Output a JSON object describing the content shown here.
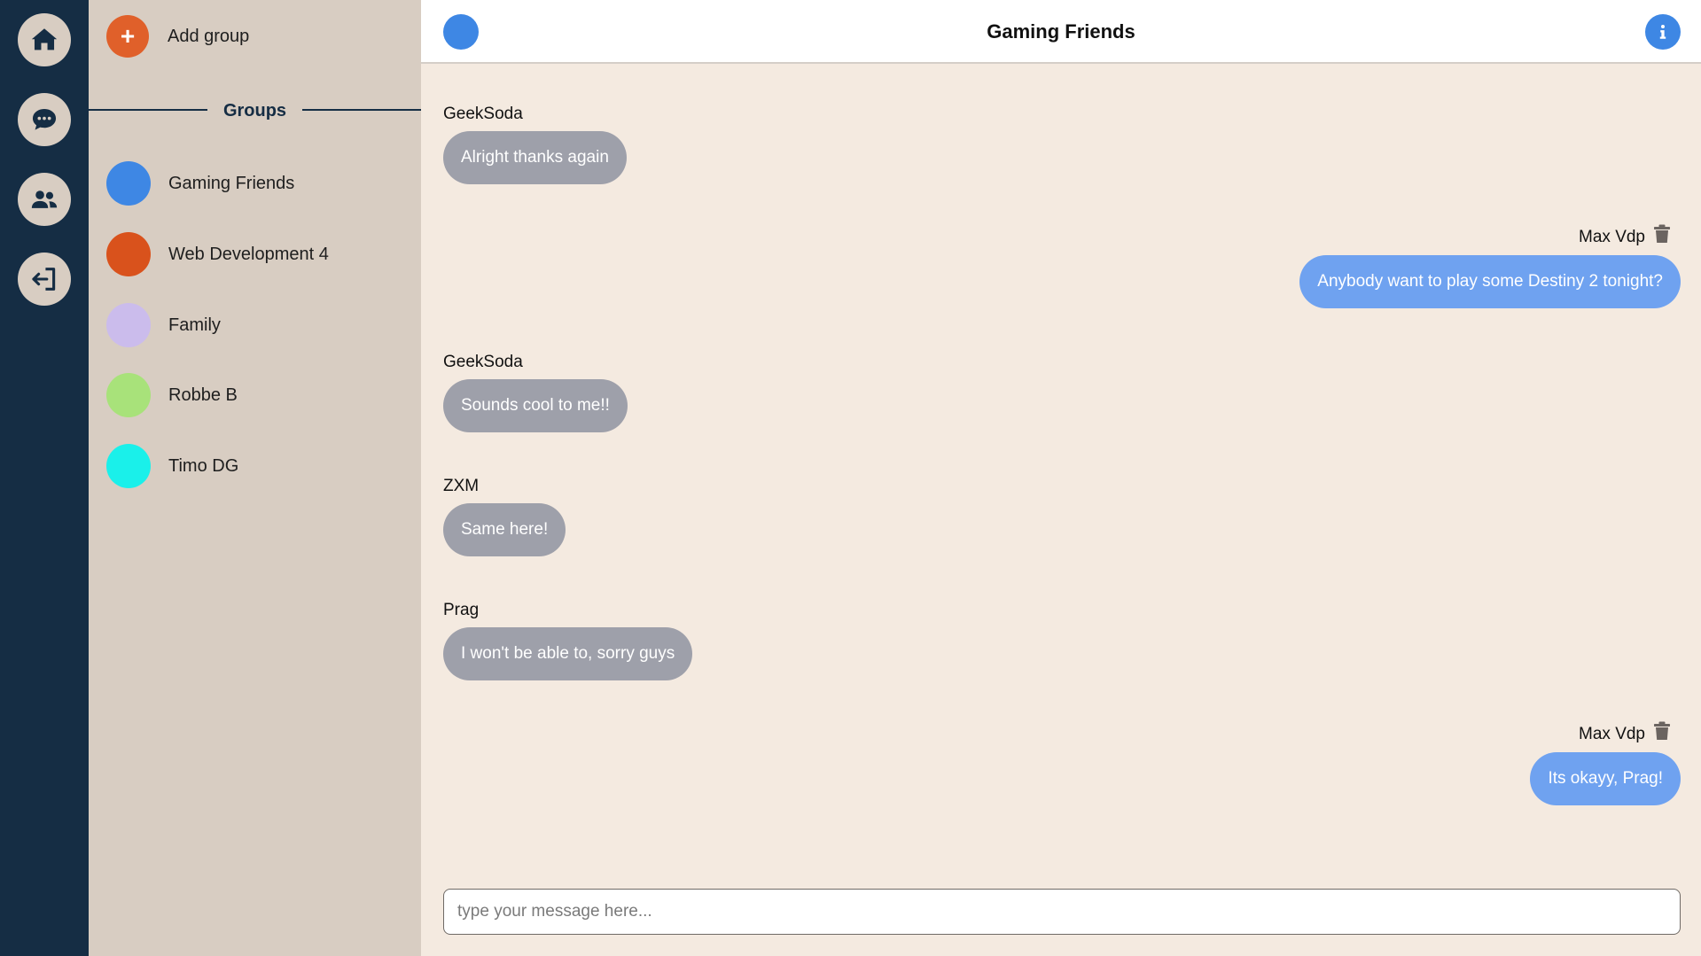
{
  "rail": {
    "items": [
      {
        "icon": "home-icon",
        "label": "Home"
      },
      {
        "icon": "chat-icon",
        "label": "Chats"
      },
      {
        "icon": "users-icon",
        "label": "Friends"
      },
      {
        "icon": "logout-icon",
        "label": "Logout"
      }
    ]
  },
  "sidebar": {
    "add_group_label": "Add group",
    "add_group_icon": "+",
    "groups_title": "Groups",
    "groups": [
      {
        "name": "Gaming Friends",
        "color": "#3e87e4"
      },
      {
        "name": "Web Development 4",
        "color": "#d9521c"
      },
      {
        "name": "Family",
        "color": "#cbbcec"
      },
      {
        "name": "Robbe B",
        "color": "#a8e27a"
      },
      {
        "name": "Timo DG",
        "color": "#1af0ea"
      }
    ]
  },
  "chat": {
    "title": "Gaming Friends",
    "avatar_color": "#3e87e4",
    "messages": [
      {
        "author": "GeekSoda",
        "text": "Alright thanks again",
        "own": false
      },
      {
        "author": "Max Vdp",
        "text": "Anybody want to play some Destiny 2 tonight?",
        "own": true
      },
      {
        "author": "GeekSoda",
        "text": "Sounds cool to me!!",
        "own": false
      },
      {
        "author": "ZXM",
        "text": "Same here!",
        "own": false
      },
      {
        "author": "Prag",
        "text": "I won't be able to, sorry guys",
        "own": false
      },
      {
        "author": "Max Vdp",
        "text": "Its okayy, Prag!",
        "own": true
      }
    ],
    "compose_placeholder": "type your message here..."
  },
  "colors": {
    "rail_bg": "#152d44",
    "sidebar_bg": "#d8cdc2",
    "chat_bg": "#f4eae0",
    "bubble_in": "#9ea0aa",
    "bubble_out": "#6fa2f0",
    "accent": "#3e87e4",
    "add_button": "#e0602a"
  }
}
